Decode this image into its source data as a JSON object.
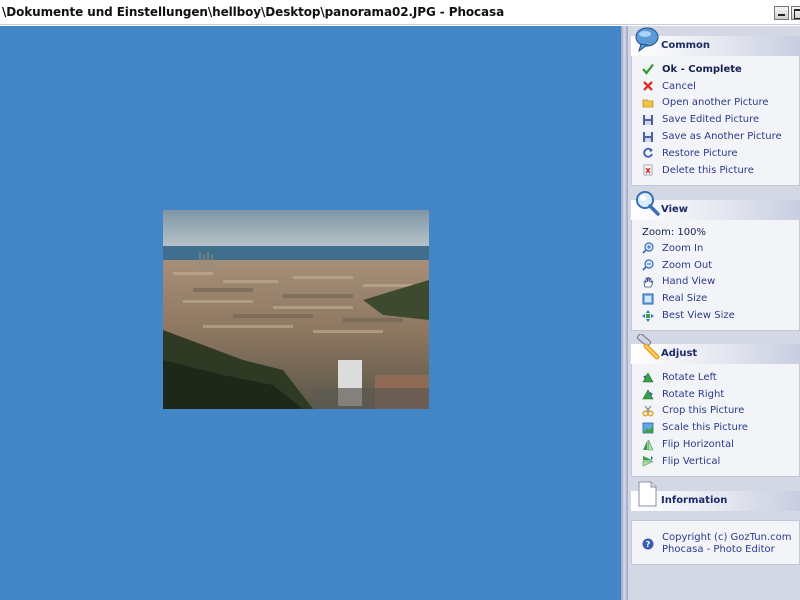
{
  "window": {
    "title": "\\Dokumente und Einstellungen\\hellboy\\Desktop\\panorama02.JPG - Phocasa"
  },
  "colors": {
    "canvas_bg": "#4286c8",
    "sidebar_bg": "#d4d8e4",
    "panel_title": "#1c2a66"
  },
  "sidebar": {
    "common": {
      "title": "Common",
      "icon": "speech-bubble-icon",
      "items": [
        {
          "label": "Ok - Complete",
          "icon": "checkmark-icon"
        },
        {
          "label": "Cancel",
          "icon": "red-x-icon"
        },
        {
          "label": "Open another Picture",
          "icon": "folder-open-icon"
        },
        {
          "label": "Save Edited Picture",
          "icon": "floppy-disk-icon"
        },
        {
          "label": "Save as Another Picture",
          "icon": "floppy-disk-icon"
        },
        {
          "label": "Restore Picture",
          "icon": "restore-arrow-icon"
        },
        {
          "label": "Delete this Picture",
          "icon": "delete-page-icon"
        }
      ]
    },
    "view": {
      "title": "View",
      "icon": "magnifier-icon",
      "zoom_text": "Zoom: 100%",
      "items": [
        {
          "label": "Zoom In",
          "icon": "zoom-in-icon"
        },
        {
          "label": "Zoom Out",
          "icon": "zoom-out-icon"
        },
        {
          "label": "Hand View",
          "icon": "hand-icon"
        },
        {
          "label": "Real Size",
          "icon": "real-size-icon"
        },
        {
          "label": "Best View Size",
          "icon": "best-fit-icon"
        }
      ]
    },
    "adjust": {
      "title": "Adjust",
      "icon": "adjust-tools-icon",
      "items": [
        {
          "label": "Rotate Left",
          "icon": "rotate-left-icon"
        },
        {
          "label": "Rotate Right",
          "icon": "rotate-right-icon"
        },
        {
          "label": "Crop this Picture",
          "icon": "crop-icon"
        },
        {
          "label": "Scale this Picture",
          "icon": "scale-icon"
        },
        {
          "label": "Flip Horizontal",
          "icon": "flip-horizontal-icon"
        },
        {
          "label": "Flip Vertical",
          "icon": "flip-vertical-icon"
        }
      ]
    },
    "information": {
      "title": "Information",
      "icon": "document-icon",
      "text": "Copyright (c) GozTun.com Phocasa - Photo Editor",
      "text_icon": "help-circle-icon"
    }
  }
}
